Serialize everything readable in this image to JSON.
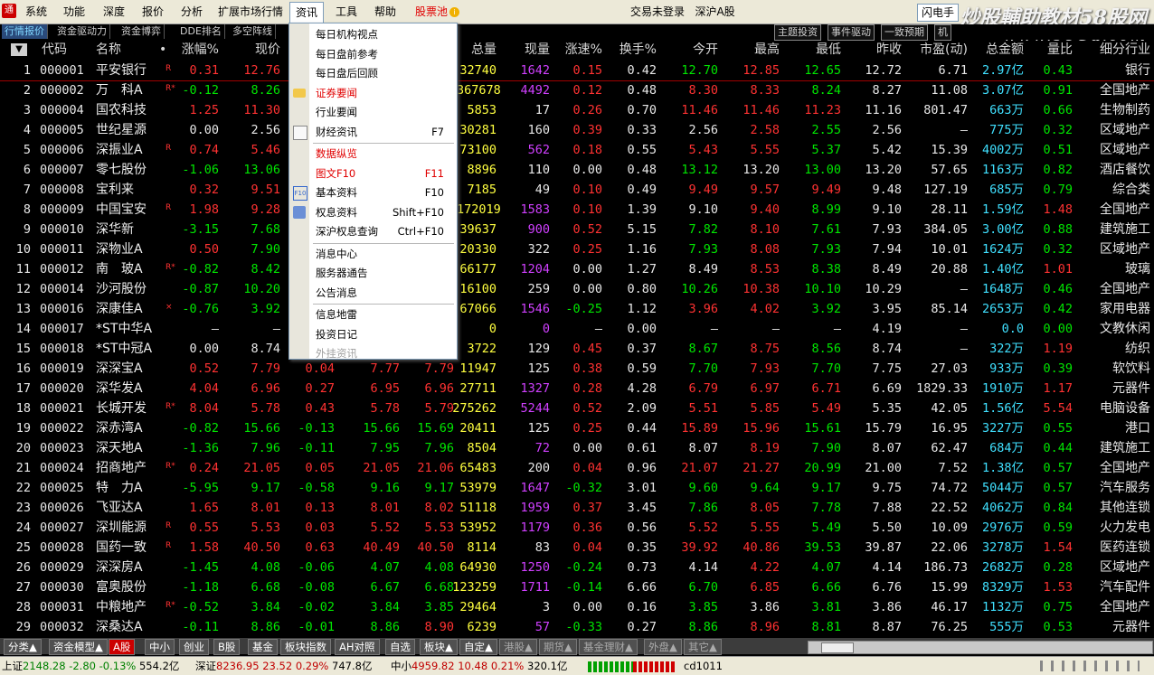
{
  "menubar": {
    "items": [
      "系统",
      "功能",
      "深度",
      "报价",
      "分析",
      "扩展市场行情",
      "资讯",
      "工具",
      "帮助"
    ],
    "stock_pool": "股票池",
    "login_status": "交易未登录",
    "market": "深沪A股",
    "login_box": "闪电手",
    "watermark": "炒股輔助教材58股网",
    "watermark_url": "www.58Gu.com"
  },
  "tabs": {
    "left": [
      "行情报价",
      "资金驱动力",
      "资金博弈",
      "DDE排名",
      "多空阵线"
    ],
    "right": [
      "主题投资",
      "事件驱动",
      "一致预期",
      "机"
    ]
  },
  "headers": {
    "sort": "▼",
    "code": "代码",
    "name": "名称",
    "mark": "•",
    "pct": "涨幅%",
    "price": "现价",
    "volume": "总量",
    "cur_vol": "现量",
    "speed": "涨速%",
    "turnover": "换手%",
    "open": "今开",
    "high": "最高",
    "low": "最低",
    "prev": "昨收",
    "pe": "市盈(动)",
    "amount": "总金额",
    "ratio": "量比",
    "industry": "细分行业"
  },
  "rows": [
    [
      "1",
      "000001",
      "平安银行",
      "R",
      "0.31",
      "12.76",
      "",
      "",
      "",
      "32740",
      "1642",
      "0.15",
      "0.42",
      "12.70",
      "12.85",
      "12.65",
      "12.72",
      "6.71",
      "2.97亿",
      "0.43",
      "银行"
    ],
    [
      "2",
      "000002",
      "万　科A",
      "R*",
      "-0.12",
      "8.26",
      "",
      "",
      "",
      "367678",
      "4492",
      "0.12",
      "0.48",
      "8.30",
      "8.33",
      "8.24",
      "8.27",
      "11.08",
      "3.07亿",
      "0.91",
      "全国地产"
    ],
    [
      "3",
      "000004",
      "国农科技",
      "",
      "1.25",
      "11.30",
      "",
      "",
      "",
      "5853",
      "17",
      "0.26",
      "0.70",
      "11.46",
      "11.46",
      "11.23",
      "11.16",
      "801.47",
      "663万",
      "0.66",
      "生物制药"
    ],
    [
      "4",
      "000005",
      "世纪星源",
      "",
      "0.00",
      "2.56",
      "",
      "",
      "",
      "30281",
      "160",
      "0.39",
      "0.33",
      "2.56",
      "2.58",
      "2.55",
      "2.56",
      "—",
      "775万",
      "0.32",
      "区域地产"
    ],
    [
      "5",
      "000006",
      "深振业A",
      "R",
      "0.74",
      "5.46",
      "",
      "",
      "",
      "73100",
      "562",
      "0.18",
      "0.55",
      "5.43",
      "5.55",
      "5.37",
      "5.42",
      "15.39",
      "4002万",
      "0.51",
      "区域地产"
    ],
    [
      "6",
      "000007",
      "零七股份",
      "",
      "-1.06",
      "13.06",
      "",
      "",
      "",
      "8896",
      "110",
      "0.00",
      "0.48",
      "13.12",
      "13.20",
      "13.00",
      "13.20",
      "57.65",
      "1163万",
      "0.82",
      "酒店餐饮"
    ],
    [
      "7",
      "000008",
      "宝利来",
      "",
      "0.32",
      "9.51",
      "",
      "",
      "",
      "7185",
      "49",
      "0.10",
      "0.49",
      "9.49",
      "9.57",
      "9.49",
      "9.48",
      "127.19",
      "685万",
      "0.79",
      "综合类"
    ],
    [
      "8",
      "000009",
      "中国宝安",
      "R",
      "1.98",
      "9.28",
      "",
      "",
      "",
      "172019",
      "1583",
      "0.10",
      "1.39",
      "9.10",
      "9.40",
      "8.99",
      "9.10",
      "28.11",
      "1.59亿",
      "1.48",
      "全国地产"
    ],
    [
      "9",
      "000010",
      "深华新",
      "",
      "-3.15",
      "7.68",
      "",
      "",
      "",
      "39637",
      "900",
      "0.52",
      "5.15",
      "7.82",
      "8.10",
      "7.61",
      "7.93",
      "384.05",
      "3.00亿",
      "0.88",
      "建筑施工"
    ],
    [
      "10",
      "000011",
      "深物业A",
      "",
      "0.50",
      "7.90",
      "",
      "",
      "",
      "20330",
      "322",
      "0.25",
      "1.16",
      "7.93",
      "8.08",
      "7.93",
      "7.94",
      "10.01",
      "1624万",
      "0.32",
      "区域地产"
    ],
    [
      "11",
      "000012",
      "南　玻A",
      "R*",
      "-0.82",
      "8.42",
      "",
      "",
      "",
      "66177",
      "1204",
      "0.00",
      "1.27",
      "8.49",
      "8.53",
      "8.38",
      "8.49",
      "20.88",
      "1.40亿",
      "1.01",
      "玻璃"
    ],
    [
      "12",
      "000014",
      "沙河股份",
      "",
      "-0.87",
      "10.20",
      "",
      "",
      "",
      "16100",
      "259",
      "0.00",
      "0.80",
      "10.26",
      "10.38",
      "10.10",
      "10.29",
      "—",
      "1648万",
      "0.46",
      "全国地产"
    ],
    [
      "13",
      "000016",
      "深康佳A",
      "×",
      "-0.76",
      "3.92",
      "",
      "",
      "",
      "67066",
      "1546",
      "-0.25",
      "1.12",
      "3.96",
      "4.02",
      "3.92",
      "3.95",
      "85.14",
      "2653万",
      "0.42",
      "家用电器"
    ],
    [
      "14",
      "000017",
      "*ST中华A",
      "",
      "—",
      "—",
      "",
      "",
      "",
      "0",
      "0",
      "—",
      "0.00",
      "—",
      "—",
      "—",
      "4.19",
      "—",
      "0.0",
      "0.00",
      "文教休闲"
    ],
    [
      "15",
      "000018",
      "*ST中冠A",
      "",
      "0.00",
      "8.74",
      "",
      "",
      "",
      "3722",
      "129",
      "0.45",
      "0.37",
      "8.67",
      "8.75",
      "8.56",
      "8.74",
      "—",
      "322万",
      "1.19",
      "纺织"
    ],
    [
      "16",
      "000019",
      "深深宝A",
      "",
      "0.52",
      "7.79",
      "0.04",
      "7.77",
      "7.79",
      "11947",
      "125",
      "0.38",
      "0.59",
      "7.70",
      "7.93",
      "7.70",
      "7.75",
      "27.03",
      "933万",
      "0.39",
      "软饮料"
    ],
    [
      "17",
      "000020",
      "深华发A",
      "",
      "4.04",
      "6.96",
      "0.27",
      "6.95",
      "6.96",
      "27711",
      "1327",
      "0.28",
      "4.28",
      "6.79",
      "6.97",
      "6.71",
      "6.69",
      "1829.33",
      "1910万",
      "1.17",
      "元器件"
    ],
    [
      "18",
      "000021",
      "长城开发",
      "R*",
      "8.04",
      "5.78",
      "0.43",
      "5.78",
      "5.79",
      "275262",
      "5244",
      "0.52",
      "2.09",
      "5.51",
      "5.85",
      "5.49",
      "5.35",
      "42.05",
      "1.56亿",
      "5.54",
      "电脑设备"
    ],
    [
      "19",
      "000022",
      "深赤湾A",
      "",
      "-0.82",
      "15.66",
      "-0.13",
      "15.66",
      "15.69",
      "20411",
      "125",
      "0.25",
      "0.44",
      "15.89",
      "15.96",
      "15.61",
      "15.79",
      "16.95",
      "3227万",
      "0.55",
      "港口"
    ],
    [
      "20",
      "000023",
      "深天地A",
      "",
      "-1.36",
      "7.96",
      "-0.11",
      "7.95",
      "7.96",
      "8504",
      "72",
      "0.00",
      "0.61",
      "8.07",
      "8.19",
      "7.90",
      "8.07",
      "62.47",
      "684万",
      "0.44",
      "建筑施工"
    ],
    [
      "21",
      "000024",
      "招商地产",
      "R*",
      "0.24",
      "21.05",
      "0.05",
      "21.05",
      "21.06",
      "65483",
      "200",
      "0.04",
      "0.96",
      "21.07",
      "21.27",
      "20.99",
      "21.00",
      "7.52",
      "1.38亿",
      "0.57",
      "全国地产"
    ],
    [
      "22",
      "000025",
      "特　力A",
      "",
      "-5.95",
      "9.17",
      "-0.58",
      "9.16",
      "9.17",
      "53979",
      "1647",
      "-0.32",
      "3.01",
      "9.60",
      "9.64",
      "9.17",
      "9.75",
      "74.72",
      "5044万",
      "0.57",
      "汽车服务"
    ],
    [
      "23",
      "000026",
      "飞亚达A",
      "",
      "1.65",
      "8.01",
      "0.13",
      "8.01",
      "8.02",
      "51118",
      "1959",
      "0.37",
      "3.45",
      "7.86",
      "8.05",
      "7.78",
      "7.88",
      "22.52",
      "4062万",
      "0.84",
      "其他连锁"
    ],
    [
      "24",
      "000027",
      "深圳能源",
      "R",
      "0.55",
      "5.53",
      "0.03",
      "5.52",
      "5.53",
      "53952",
      "1179",
      "0.36",
      "0.56",
      "5.52",
      "5.55",
      "5.49",
      "5.50",
      "10.09",
      "2976万",
      "0.59",
      "火力发电"
    ],
    [
      "25",
      "000028",
      "国药一致",
      "R",
      "1.58",
      "40.50",
      "0.63",
      "40.49",
      "40.50",
      "8114",
      "83",
      "0.04",
      "0.35",
      "39.92",
      "40.86",
      "39.53",
      "39.87",
      "22.06",
      "3278万",
      "1.54",
      "医药连锁"
    ],
    [
      "26",
      "000029",
      "深深房A",
      "",
      "-1.45",
      "4.08",
      "-0.06",
      "4.07",
      "4.08",
      "64930",
      "1250",
      "-0.24",
      "0.73",
      "4.14",
      "4.22",
      "4.07",
      "4.14",
      "186.73",
      "2682万",
      "0.28",
      "区域地产"
    ],
    [
      "27",
      "000030",
      "富奥股份",
      "",
      "-1.18",
      "6.68",
      "-0.08",
      "6.67",
      "6.68",
      "123259",
      "1711",
      "-0.14",
      "6.66",
      "6.70",
      "6.85",
      "6.66",
      "6.76",
      "15.99",
      "8329万",
      "1.53",
      "汽车配件"
    ],
    [
      "28",
      "000031",
      "中粮地产",
      "R*",
      "-0.52",
      "3.84",
      "-0.02",
      "3.84",
      "3.85",
      "29464",
      "3",
      "0.00",
      "0.16",
      "3.85",
      "3.86",
      "3.81",
      "3.86",
      "46.17",
      "1132万",
      "0.75",
      "全国地产"
    ],
    [
      "29",
      "000032",
      "深桑达A",
      "",
      "-0.11",
      "8.86",
      "-0.01",
      "8.86",
      "8.90",
      "6239",
      "57",
      "-0.33",
      "0.27",
      "8.86",
      "8.96",
      "8.81",
      "8.87",
      "76.25",
      "555万",
      "0.53",
      "元器件"
    ]
  ],
  "dropdown": {
    "items": [
      {
        "label": "每日机构视点",
        "short": "",
        "style": ""
      },
      {
        "label": "每日盘前参考",
        "short": "",
        "style": ""
      },
      {
        "label": "每日盘后回顾",
        "short": "",
        "style": ""
      },
      {
        "label": "证券要闻",
        "short": "",
        "style": "red",
        "icon": "folder-icon"
      },
      {
        "label": "行业要闻",
        "short": "",
        "style": ""
      },
      {
        "label": "财经资讯",
        "short": "F7",
        "style": "",
        "icon": "news-icon"
      },
      {
        "label": "数据纵览",
        "short": "",
        "style": "red"
      },
      {
        "label": "图文F10",
        "short": "F11",
        "style": "red"
      },
      {
        "label": "基本资料",
        "short": "F10",
        "style": "",
        "icon": "f10-icon"
      },
      {
        "label": "权息资料",
        "short": "Shift+F10",
        "style": "",
        "icon": "doc-icon"
      },
      {
        "label": "深沪权息查询",
        "short": "Ctrl+F10",
        "style": ""
      },
      {
        "label": "消息中心",
        "short": "",
        "style": ""
      },
      {
        "label": "服务器通告",
        "short": "",
        "style": ""
      },
      {
        "label": "公告消息",
        "short": "",
        "style": ""
      },
      {
        "label": "信息地雷",
        "short": "",
        "style": ""
      },
      {
        "label": "投资日记",
        "short": "",
        "style": ""
      },
      {
        "label": "外挂资讯",
        "short": "",
        "style": "dis"
      }
    ]
  },
  "bottom_tabs": [
    "分类▲",
    "资金模型▲",
    "A股",
    "中小",
    "创业",
    "B股",
    "基金",
    "板块指数",
    "AH对照",
    "自选",
    "板块▲",
    "自定▲",
    "港股▲",
    "期货▲",
    "基金理财▲",
    "外盘▲",
    "其它▲"
  ],
  "status": {
    "sh_label": "上证",
    "sh_index": "2148.28",
    "sh_change": "-2.80",
    "sh_pct": "-0.13%",
    "sh_amount": "554.2亿",
    "sz_label": "深证",
    "sz_index": "8236.95",
    "sz_change": "23.52",
    "sz_pct": "0.29%",
    "sz_amount": "747.8亿",
    "zx_label": "中小",
    "zx_index": "4959.82",
    "zx_change": "10.48",
    "zx_pct": "0.21%",
    "zx_amount": "320.1亿",
    "server": "cd1011"
  },
  "colors": {
    "up": "#ff3232",
    "down": "#00e600",
    "flat": "#e8e8e8",
    "volume": "#ffff40",
    "cur_vol": "#d040ff",
    "amount": "#40e0ff"
  }
}
